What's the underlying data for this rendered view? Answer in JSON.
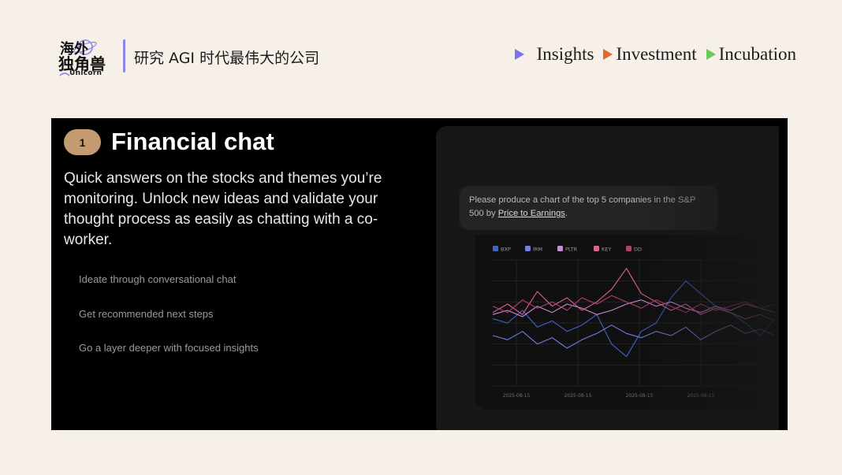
{
  "header": {
    "logo_alt": "海外独角兽",
    "logo_sub": "Unicorn",
    "tagline": "研究 AGI 时代最伟大的公司",
    "nav": [
      {
        "label": "Insights",
        "color": "#7b74ef"
      },
      {
        "label": "Investment",
        "color": "#e06b2c"
      },
      {
        "label": "Incubation",
        "color": "#6ac75a"
      }
    ]
  },
  "slide": {
    "step": "1",
    "title": "Financial chat",
    "description": "Quick answers on the stocks and themes you’re monitoring. Unlock new ideas and validate your thought process as easily as chatting with a co-worker.",
    "bullets": [
      "Ideate through conversational chat",
      "Get recommended next steps",
      "Go a layer deeper with focused insights"
    ]
  },
  "prompt": {
    "text_before": "Please produce a chart of the top 5 companies in the S&P 500 by ",
    "link": "Price to Earnings",
    "text_after": "."
  },
  "chart_data": {
    "type": "line",
    "legend_position": "top-left",
    "grid": true,
    "x_ticks": [
      "2025-08-15",
      "2025-08-15",
      "2025-08-15",
      "2025-08-15"
    ],
    "series": [
      {
        "name": "BXP",
        "color": "#3f63c7",
        "values": [
          3.2,
          3.0,
          3.6,
          2.8,
          3.1,
          2.6,
          2.9,
          3.4,
          2.0,
          1.4,
          2.6,
          3.0,
          4.2,
          5.0,
          4.4,
          3.8,
          3.5,
          3.0,
          2.4,
          3.2
        ]
      },
      {
        "name": "IRM",
        "color": "#6f7fe0",
        "values": [
          2.4,
          2.2,
          2.6,
          2.0,
          2.3,
          1.8,
          2.2,
          2.5,
          2.9,
          2.5,
          2.3,
          2.6,
          2.4,
          2.8,
          2.2,
          2.6,
          2.9,
          2.5,
          2.7,
          2.4
        ]
      },
      {
        "name": "PLTR",
        "color": "#c98ad8",
        "values": [
          3.4,
          3.6,
          3.3,
          3.8,
          3.5,
          3.9,
          3.7,
          3.4,
          3.6,
          3.9,
          4.1,
          3.8,
          4.0,
          3.7,
          3.5,
          3.8,
          3.6,
          3.9,
          3.7,
          3.5
        ]
      },
      {
        "name": "KEY",
        "color": "#e05f96",
        "values": [
          3.5,
          3.9,
          3.4,
          4.5,
          3.8,
          4.2,
          3.6,
          4.0,
          4.6,
          5.6,
          4.4,
          4.0,
          3.6,
          3.9,
          3.4,
          3.7,
          3.5,
          3.2,
          3.4,
          3.1
        ]
      },
      {
        "name": "DD",
        "color": "#b1426b",
        "values": [
          3.8,
          3.5,
          4.1,
          3.7,
          4.0,
          3.6,
          4.2,
          3.9,
          4.3,
          4.0,
          3.7,
          4.1,
          3.8,
          3.5,
          3.9,
          3.6,
          3.8,
          4.0,
          3.7,
          3.9
        ]
      }
    ],
    "ylim": [
      0,
      6
    ]
  }
}
